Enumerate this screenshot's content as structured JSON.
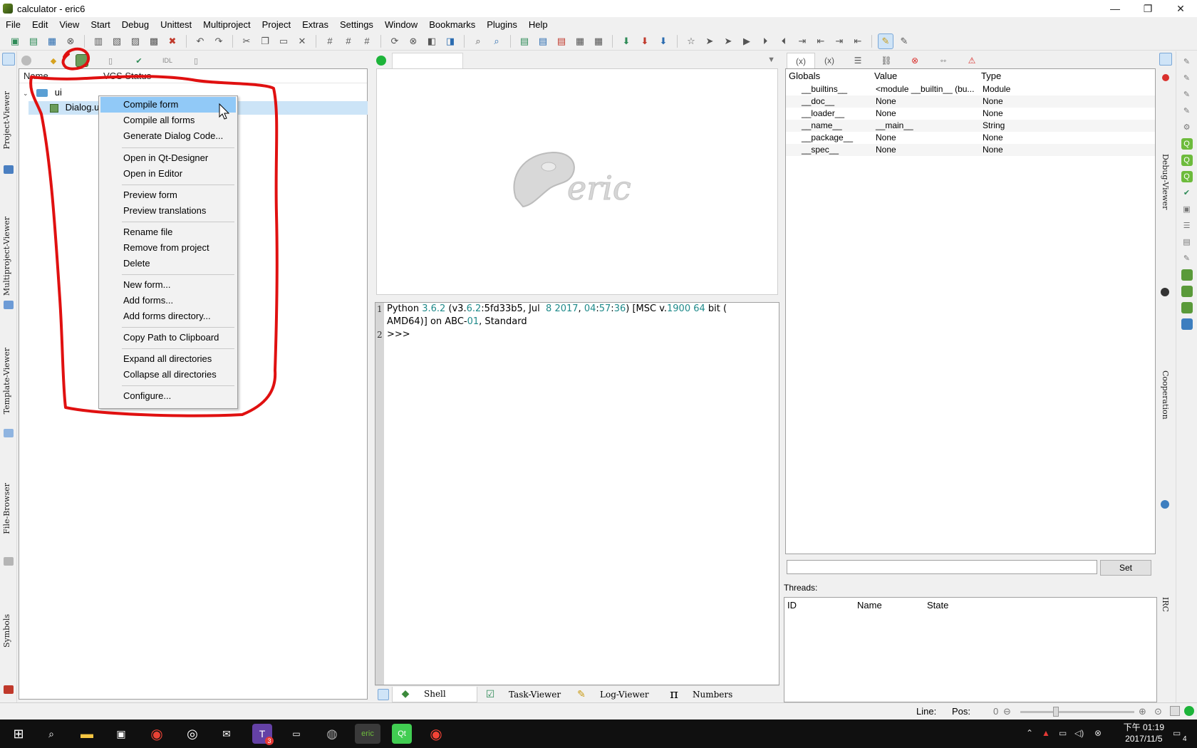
{
  "window": {
    "title": "calculator - eric6",
    "controls": [
      "—",
      "❐",
      "✕"
    ]
  },
  "menu": [
    "File",
    "Edit",
    "View",
    "Start",
    "Debug",
    "Unittest",
    "Multiproject",
    "Project",
    "Extras",
    "Settings",
    "Window",
    "Bookmarks",
    "Plugins",
    "Help"
  ],
  "left_sidebar": [
    "Project-Viewer",
    "Multiproject-Viewer",
    "Template-Viewer",
    "File-Browser",
    "Symbols"
  ],
  "right_sidebar": [
    "Debug-Viewer",
    "Cooperation",
    "IRC"
  ],
  "project_viewer": {
    "columns": [
      "Name",
      "VCS Status"
    ],
    "tree": [
      {
        "label": "ui",
        "type": "folder"
      },
      {
        "label": "Dialog.ui",
        "type": "form",
        "visible_label": "Dialog.u"
      }
    ]
  },
  "context_menu": {
    "groups": [
      [
        "Compile form",
        "Compile all forms",
        "Generate Dialog Code..."
      ],
      [
        "Open in Qt-Designer",
        "Open in Editor"
      ],
      [
        "Preview form",
        "Preview translations"
      ],
      [
        "Rename file",
        "Remove from project",
        "Delete"
      ],
      [
        "New form...",
        "Add forms...",
        "Add forms directory..."
      ],
      [
        "Copy Path to Clipboard"
      ],
      [
        "Expand all directories",
        "Collapse all directories"
      ],
      [
        "Configure..."
      ]
    ],
    "highlighted": "Compile form"
  },
  "shell": {
    "lines": [
      {
        "num": "1",
        "text": "Python 3.6.2 (v3.6.2:5fd33b5, Jul  8 2017, 04:57:36) [MSC v.1900 64 bit ("
      },
      {
        "num": "",
        "text": "AMD64)] on ABC-01, Standard"
      },
      {
        "num": "2",
        "text": ">>>"
      }
    ]
  },
  "bottom_tabs": [
    "Shell",
    "Task-Viewer",
    "Log-Viewer",
    "Numbers"
  ],
  "debug_viewer": {
    "columns": [
      "Globals",
      "Value",
      "Type"
    ],
    "rows": [
      {
        "name": "__builtins__",
        "value": "<module __builtin__ (bu...",
        "type": "Module"
      },
      {
        "name": "__doc__",
        "value": "None",
        "type": "None"
      },
      {
        "name": "__loader__",
        "value": "None",
        "type": "None"
      },
      {
        "name": "__name__",
        "value": "__main__",
        "type": "String"
      },
      {
        "name": "__package__",
        "value": "None",
        "type": "None"
      },
      {
        "name": "__spec__",
        "value": "None",
        "type": "None"
      }
    ],
    "set_label": "Set",
    "threads_label": "Threads:",
    "thread_columns": [
      "ID",
      "Name",
      "State"
    ]
  },
  "statusbar": {
    "line_label": "Line:",
    "pos_label": "Pos:",
    "zoom_value": "0"
  },
  "taskbar": {
    "time": "下午 01:19",
    "date": "2017/11/5",
    "notification_count": "4",
    "twitch_badge": "3"
  },
  "accent_colors": {
    "selection": "#91c9f7",
    "annotation": "#e01010",
    "run_green": "#1db43a"
  }
}
